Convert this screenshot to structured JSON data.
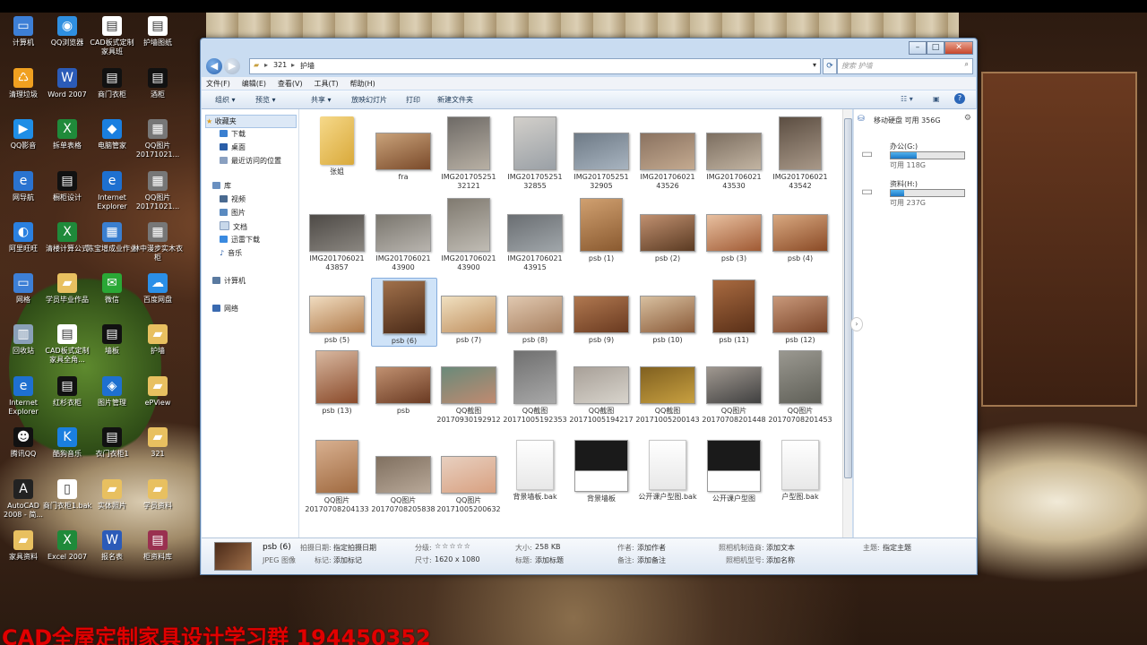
{
  "desktop": {
    "icons": [
      {
        "label": "计算机",
        "color": "#3d7fd6",
        "glyph": "▭"
      },
      {
        "label": "QQ浏览器",
        "color": "#2f8fe0",
        "glyph": "◉"
      },
      {
        "label": "CAD板式定制家具班",
        "color": "#ffffff",
        "glyph": "▤"
      },
      {
        "label": "护墙图纸",
        "color": "#ffffff",
        "glyph": "▤"
      },
      {
        "label": "清理垃圾",
        "color": "#f0a020",
        "glyph": "♺"
      },
      {
        "label": "Word 2007",
        "color": "#2b5bb8",
        "glyph": "W"
      },
      {
        "label": "商门衣柜",
        "color": "#111111",
        "glyph": "▤"
      },
      {
        "label": "酒柜",
        "color": "#111111",
        "glyph": "▤"
      },
      {
        "label": "QQ影音",
        "color": "#1f8ee6",
        "glyph": "▶"
      },
      {
        "label": "拆单表格",
        "color": "#1f8a3a",
        "glyph": "X"
      },
      {
        "label": "电脑管家",
        "color": "#1a7fe0",
        "glyph": "◆"
      },
      {
        "label": "QQ图片20171021...",
        "color": "#777777",
        "glyph": "▦"
      },
      {
        "label": "网导航",
        "color": "#2a73d0",
        "glyph": "e"
      },
      {
        "label": "橱柜设计",
        "color": "#111111",
        "glyph": "▤"
      },
      {
        "label": "Internet Explorer",
        "color": "#1e70d0",
        "glyph": "e"
      },
      {
        "label": "QQ图片20171021...",
        "color": "#777777",
        "glyph": "▦"
      },
      {
        "label": "阿里旺旺",
        "color": "#2a80e0",
        "glyph": "◐"
      },
      {
        "label": "清楼计算公式",
        "color": "#1f8a3a",
        "glyph": "X"
      },
      {
        "label": "陈宝增成业作业",
        "color": "#3a7fd0",
        "glyph": "▦"
      },
      {
        "label": "林中漫步实木衣柜",
        "color": "#777777",
        "glyph": "▦"
      },
      {
        "label": "网格",
        "color": "#3d7fd6",
        "glyph": "▭"
      },
      {
        "label": "学员毕业作品",
        "color": "#e8c060",
        "glyph": "▰"
      },
      {
        "label": "微信",
        "color": "#2aa836",
        "glyph": "✉"
      },
      {
        "label": "百度网盘",
        "color": "#2a8fe8",
        "glyph": "☁"
      },
      {
        "label": "回收站",
        "color": "#8aa0b8",
        "glyph": "▥"
      },
      {
        "label": "CAD板式定制家具全角...",
        "color": "#ffffff",
        "glyph": "▤"
      },
      {
        "label": "墙板",
        "color": "#111111",
        "glyph": "▤"
      },
      {
        "label": "护墙",
        "color": "#e8c060",
        "glyph": "▰"
      },
      {
        "label": "Internet Explorer",
        "color": "#1e70d0",
        "glyph": "e"
      },
      {
        "label": "红杉衣柜",
        "color": "#111111",
        "glyph": "▤"
      },
      {
        "label": "图片管理",
        "color": "#1e70d0",
        "glyph": "◈"
      },
      {
        "label": "ePView",
        "color": "#e8c060",
        "glyph": "▰"
      },
      {
        "label": "腾讯QQ",
        "color": "#111111",
        "glyph": "☻"
      },
      {
        "label": "酷狗音乐",
        "color": "#1a7fe0",
        "glyph": "K"
      },
      {
        "label": "衣门衣柜1",
        "color": "#111111",
        "glyph": "▤"
      },
      {
        "label": "321",
        "color": "#e8c060",
        "glyph": "▰"
      },
      {
        "label": "AutoCAD 2008 - 简...",
        "color": "#222222",
        "glyph": "A"
      },
      {
        "label": "商门衣柜1.bak",
        "color": "#ffffff",
        "glyph": "▯"
      },
      {
        "label": "实体照片",
        "color": "#e8c060",
        "glyph": "▰"
      },
      {
        "label": "学员资料",
        "color": "#e8c060",
        "glyph": "▰"
      },
      {
        "label": "家具资料",
        "color": "#e8c060",
        "glyph": "▰"
      },
      {
        "label": "Excel 2007",
        "color": "#1f8a3a",
        "glyph": "X"
      },
      {
        "label": "报名表",
        "color": "#2b5bb8",
        "glyph": "W"
      },
      {
        "label": "柜资料库",
        "color": "#9a3050",
        "glyph": "▤"
      }
    ],
    "watermark": "CAD全屋定制家具设计学习群 194450352"
  },
  "window": {
    "address": {
      "segments": [
        "321",
        "护墙"
      ],
      "separator": "▸"
    },
    "search_placeholder": "搜索 护墙",
    "menu": [
      "文件(F)",
      "编辑(E)",
      "查看(V)",
      "工具(T)",
      "帮助(H)"
    ],
    "toolbar": [
      "组织 ▾",
      "预览 ▾",
      "共享 ▾",
      "放映幻灯片",
      "打印",
      "新建文件夹"
    ],
    "nav": {
      "favorites_header": "收藏夹",
      "favorites": [
        "下载",
        "桌面",
        "最近访问的位置"
      ],
      "libraries_header": "库",
      "libraries": [
        "视频",
        "图片",
        "文档",
        "迅雷下载",
        "音乐"
      ],
      "computer": "计算机",
      "network": "网络"
    },
    "files": [
      {
        "name": "张姐",
        "type": "folder"
      },
      {
        "name": "fra",
        "type": "photo",
        "c1": "#7a4a2a",
        "c2": "#c9a27a"
      },
      {
        "name": "IMG201705251 32121",
        "type": "photo",
        "c1": "#b8b0a4",
        "c2": "#6e6a66"
      },
      {
        "name": "IMG201705251 32855",
        "type": "photo",
        "c1": "#9aa0a6",
        "c2": "#d2cfca"
      },
      {
        "name": "IMG201705251 32905",
        "type": "photo",
        "c1": "#a8b4c0",
        "c2": "#6e7a86"
      },
      {
        "name": "IMG201706021 43526",
        "type": "photo",
        "c1": "#c4aa90",
        "c2": "#8a7260"
      },
      {
        "name": "IMG201706021 43530",
        "type": "photo",
        "c1": "#c2b4a2",
        "c2": "#7c6e60"
      },
      {
        "name": "IMG201706021 43542",
        "type": "photo",
        "c1": "#a89888",
        "c2": "#5c4e42"
      },
      {
        "name": "IMG201706021 43857",
        "type": "photo",
        "c1": "#8a8680",
        "c2": "#4e4a46"
      },
      {
        "name": "IMG201706021 43900",
        "type": "photo",
        "c1": "#b8b4ae",
        "c2": "#7a766e"
      },
      {
        "name": "IMG201706021 43900",
        "type": "photo",
        "c1": "#c0bcb4",
        "c2": "#807a70"
      },
      {
        "name": "IMG201706021 43915",
        "type": "photo",
        "c1": "#a0a6aa",
        "c2": "#6a6e72"
      },
      {
        "name": "psb (1)",
        "type": "photo",
        "c1": "#8a5a30",
        "c2": "#d0a070"
      },
      {
        "name": "psb (2)",
        "type": "photo",
        "c1": "#5a3a22",
        "c2": "#c09070"
      },
      {
        "name": "psb (3)",
        "type": "photo",
        "c1": "#a05a34",
        "c2": "#e8c0a0"
      },
      {
        "name": "psb (4)",
        "type": "photo",
        "c1": "#8a4a26",
        "c2": "#d8a880"
      },
      {
        "name": "psb (5)",
        "type": "photo",
        "c1": "#b07a4a",
        "c2": "#f0dcc0"
      },
      {
        "name": "psb (6)",
        "type": "photo",
        "c1": "#4a2a18",
        "c2": "#a0704a"
      },
      {
        "name": "psb (7)",
        "type": "photo",
        "c1": "#c09060",
        "c2": "#f0e0c0"
      },
      {
        "name": "psb (8)",
        "type": "photo",
        "c1": "#a88060",
        "c2": "#e0c8b0"
      },
      {
        "name": "psb (9)",
        "type": "photo",
        "c1": "#6a3a20",
        "c2": "#b07850"
      },
      {
        "name": "psb (10)",
        "type": "photo",
        "c1": "#8a5a38",
        "c2": "#d8c0a0"
      },
      {
        "name": "psb (11)",
        "type": "photo",
        "c1": "#5a3018",
        "c2": "#a86a40"
      },
      {
        "name": "psb (12)",
        "type": "photo",
        "c1": "#7a4428",
        "c2": "#c8987a"
      },
      {
        "name": "psb (13)",
        "type": "photo",
        "c1": "#8a4a2a",
        "c2": "#d8b8a0"
      },
      {
        "name": "psb",
        "type": "photo",
        "c1": "#6a3a22",
        "c2": "#c09070"
      },
      {
        "name": "QQ截图 20170930192912",
        "type": "photo",
        "c1": "#c08a70",
        "c2": "#6a8a7a"
      },
      {
        "name": "QQ截图 20171005192353",
        "type": "photo",
        "c1": "#a8a8a8",
        "c2": "#707070"
      },
      {
        "name": "QQ截图 20171005194217",
        "type": "photo",
        "c1": "#d8d4cc",
        "c2": "#a8a098"
      },
      {
        "name": "QQ截图 20171005200143",
        "type": "photo",
        "c1": "#c8a040",
        "c2": "#806020"
      },
      {
        "name": "QQ图片 20170708201448",
        "type": "photo",
        "c1": "#404040",
        "c2": "#a09890"
      },
      {
        "name": "QQ图片 20170708201453",
        "type": "photo",
        "c1": "#606058",
        "c2": "#9a9890"
      },
      {
        "name": "QQ图片 20170708204133",
        "type": "photo",
        "c1": "#a06a40",
        "c2": "#d8b090"
      },
      {
        "name": "QQ图片 20170708205838",
        "type": "photo",
        "c1": "#b8a898",
        "c2": "#807060"
      },
      {
        "name": "QQ图片 20171005200632",
        "type": "photo",
        "c1": "#d8a080",
        "c2": "#e8d0c0"
      },
      {
        "name": "背景墙板.bak",
        "type": "doc"
      },
      {
        "name": "背景墙板",
        "type": "dwg"
      },
      {
        "name": "公开课户型图.bak",
        "type": "doc"
      },
      {
        "name": "公开课户型图",
        "type": "dwg"
      },
      {
        "name": "户型图.bak",
        "type": "doc"
      }
    ],
    "selected_index": 17,
    "preview": {
      "header": "移动硬盘 可用 356G",
      "drives": [
        {
          "name": "办公(G:)",
          "free": "可用 118G",
          "used": 0.35
        },
        {
          "name": "资料(H:)",
          "free": "可用 237G",
          "used": 0.18
        }
      ]
    },
    "details": {
      "name": "psb (6)",
      "type": "JPEG 图像",
      "fields": [
        {
          "k": "拍摄日期:",
          "v": "指定拍摄日期"
        },
        {
          "k": "标记:",
          "v": "添加标记"
        },
        {
          "k": "分级:",
          "v": "☆☆☆☆☆"
        },
        {
          "k": "尺寸:",
          "v": "1620 x 1080"
        },
        {
          "k": "大小:",
          "v": "258 KB"
        },
        {
          "k": "标题:",
          "v": "添加标题"
        },
        {
          "k": "作者:",
          "v": "添加作者"
        },
        {
          "k": "备注:",
          "v": "添加备注"
        },
        {
          "k": "照相机制造商:",
          "v": "添加文本"
        },
        {
          "k": "照相机型号:",
          "v": "添加名称"
        },
        {
          "k": "主题:",
          "v": "指定主题"
        }
      ]
    }
  }
}
